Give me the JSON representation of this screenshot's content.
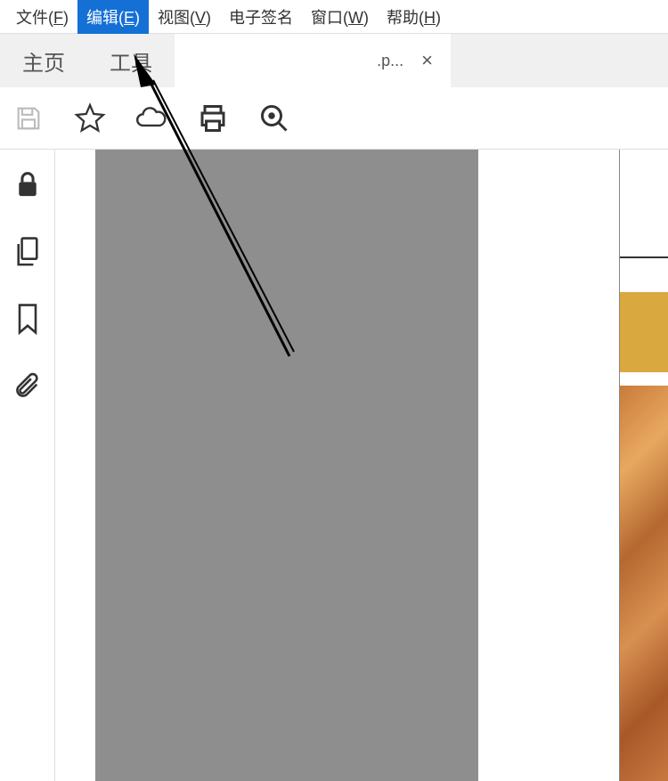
{
  "menubar": {
    "file": {
      "text": "文件",
      "key": "F"
    },
    "edit": {
      "text": "编辑",
      "key": "E"
    },
    "view": {
      "text": "视图",
      "key": "V"
    },
    "sign": {
      "text": "电子签名"
    },
    "window": {
      "text": "窗口",
      "key": "W"
    },
    "help": {
      "text": "帮助",
      "key": "H"
    }
  },
  "tabs": {
    "home": "主页",
    "tools": "工具",
    "doc": ".p...",
    "close": "×"
  }
}
